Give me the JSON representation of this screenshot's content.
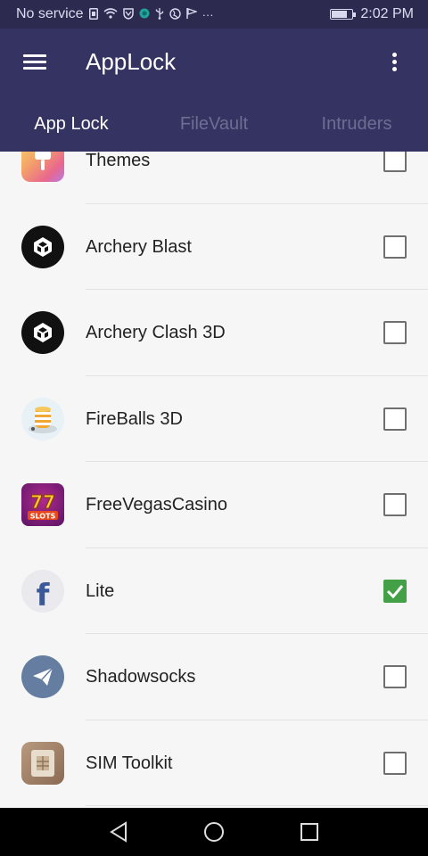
{
  "status_bar": {
    "carrier": "No service",
    "time": "2:02 PM",
    "icons": [
      "sim-icon",
      "wifi-icon",
      "shield-icon",
      "app-notification-icon",
      "usb-icon",
      "globe-icon",
      "flag-icon",
      "more-notifications-icon",
      "battery-icon"
    ],
    "more_glyph": "···"
  },
  "app_bar": {
    "title": "AppLock",
    "background": "#353361",
    "menu_icon": "hamburger-menu-icon",
    "overflow_icon": "more-vert-icon"
  },
  "tabs": [
    {
      "label": "App Lock",
      "active": true
    },
    {
      "label": "FileVault",
      "active": false
    },
    {
      "label": "Intruders",
      "active": false
    }
  ],
  "apps": [
    {
      "name": "Themes",
      "icon": "themes-app-icon",
      "checked": false
    },
    {
      "name": "Archery Blast",
      "icon": "unity-icon",
      "checked": false
    },
    {
      "name": "Archery Clash 3D",
      "icon": "unity-icon",
      "checked": false
    },
    {
      "name": "FireBalls 3D",
      "icon": "fireballs-app-icon",
      "checked": false
    },
    {
      "name": "FreeVegasCasino",
      "icon": "slots-app-icon",
      "checked": false,
      "icon_text": "SLOTS"
    },
    {
      "name": "Lite",
      "icon": "facebook-icon",
      "checked": true,
      "icon_text": "f"
    },
    {
      "name": "Shadowsocks",
      "icon": "paper-plane-icon",
      "checked": false
    },
    {
      "name": "SIM Toolkit",
      "icon": "sim-card-icon",
      "checked": false
    }
  ],
  "check_color": "#43a047",
  "nav_bar": {
    "buttons": [
      "back-icon",
      "home-icon",
      "recents-icon"
    ]
  }
}
